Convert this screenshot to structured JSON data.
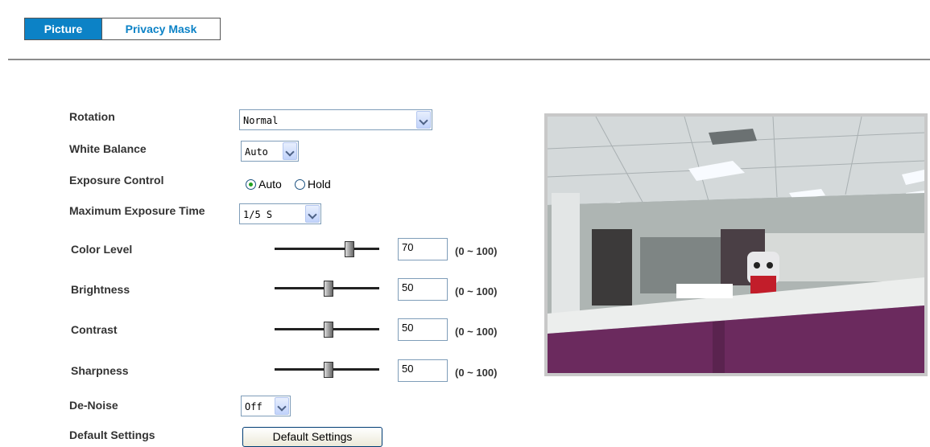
{
  "tabs": [
    {
      "label": "Picture",
      "active": true
    },
    {
      "label": "Privacy Mask",
      "active": false
    }
  ],
  "form": {
    "rotation": {
      "label": "Rotation",
      "value": "Normal"
    },
    "white_balance": {
      "label": "White Balance",
      "value": "Auto"
    },
    "exposure_control": {
      "label": "Exposure Control",
      "options": [
        "Auto",
        "Hold"
      ],
      "selected": "Auto"
    },
    "max_exposure": {
      "label": "Maximum Exposure Time",
      "value": "1/5 S"
    },
    "color_level": {
      "label": "Color Level",
      "value": "70",
      "range": "(0 ~ 100)"
    },
    "brightness": {
      "label": "Brightness",
      "value": "50",
      "range": "(0 ~ 100)"
    },
    "contrast": {
      "label": "Contrast",
      "value": "50",
      "range": "(0 ~ 100)"
    },
    "sharpness": {
      "label": "Sharpness",
      "value": "50",
      "range": "(0 ~ 100)"
    },
    "denoise": {
      "label": "De-Noise",
      "value": "Off"
    },
    "default_settings": {
      "label": "Default Settings",
      "button": "Default Settings"
    }
  },
  "colors": {
    "accent": "#0c82c6"
  }
}
